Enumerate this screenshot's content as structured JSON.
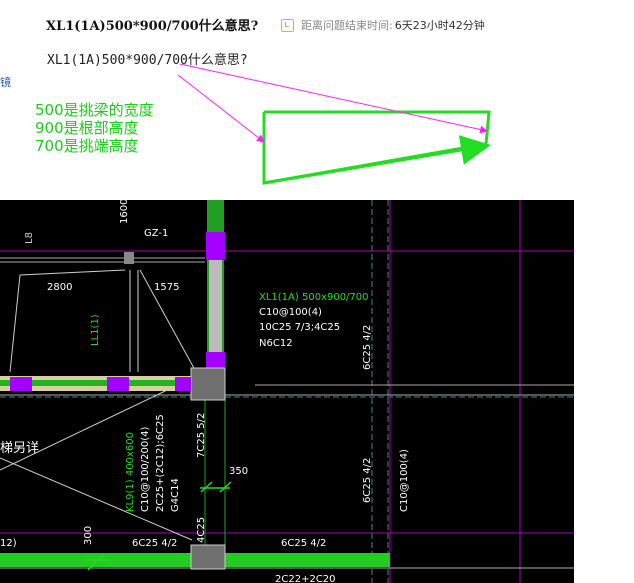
{
  "question": {
    "title": "XL1(1A)500*900/700什么意思?",
    "timer_label": "距离问题结束时间:",
    "timer_value": "6天23小时42分钟",
    "body": "XL1(1A)500*900/700什么意思?",
    "side_glyph": "镜"
  },
  "answer_note": {
    "lines": [
      "500是挑梁的宽度",
      "900是根部高度",
      "700是挑端高度"
    ]
  },
  "drawing": {
    "dim_1600": "1600",
    "gz": "GZ-1",
    "dim_2800": "2800",
    "dim_1575": "1575",
    "ll": "LL1(1)",
    "xl_title": "XL1(1A) 500x900/700",
    "xl_stirrup": "C10@100(4)",
    "xl_bars": "10C25 7/3;4C25",
    "xl_side": "N6C12",
    "rebar_6c25_42_a": "6C25 4/2",
    "rebar_7c25_52": "7C25 5/2",
    "dim_350": "350",
    "rebar_6c25_42_b": "6C25 4/2",
    "c10_100_4": "C10@100(4)",
    "kl_title": "KL9(1) 400x600",
    "kl_stirrup": "C10@100/200(4)",
    "kl_bars": "2C25+(2C12);6C25",
    "kl_side": "G4C14",
    "partial_stair": "梯另详",
    "r_4c25": "4C25",
    "r_6c25_42_c": "6C25 4/2",
    "r_6c25_42_d": "6C25 4/2",
    "r_12": "12)",
    "dim_300": "300",
    "r_2c22": "2C22+2C20",
    "r_l8": "L8"
  }
}
